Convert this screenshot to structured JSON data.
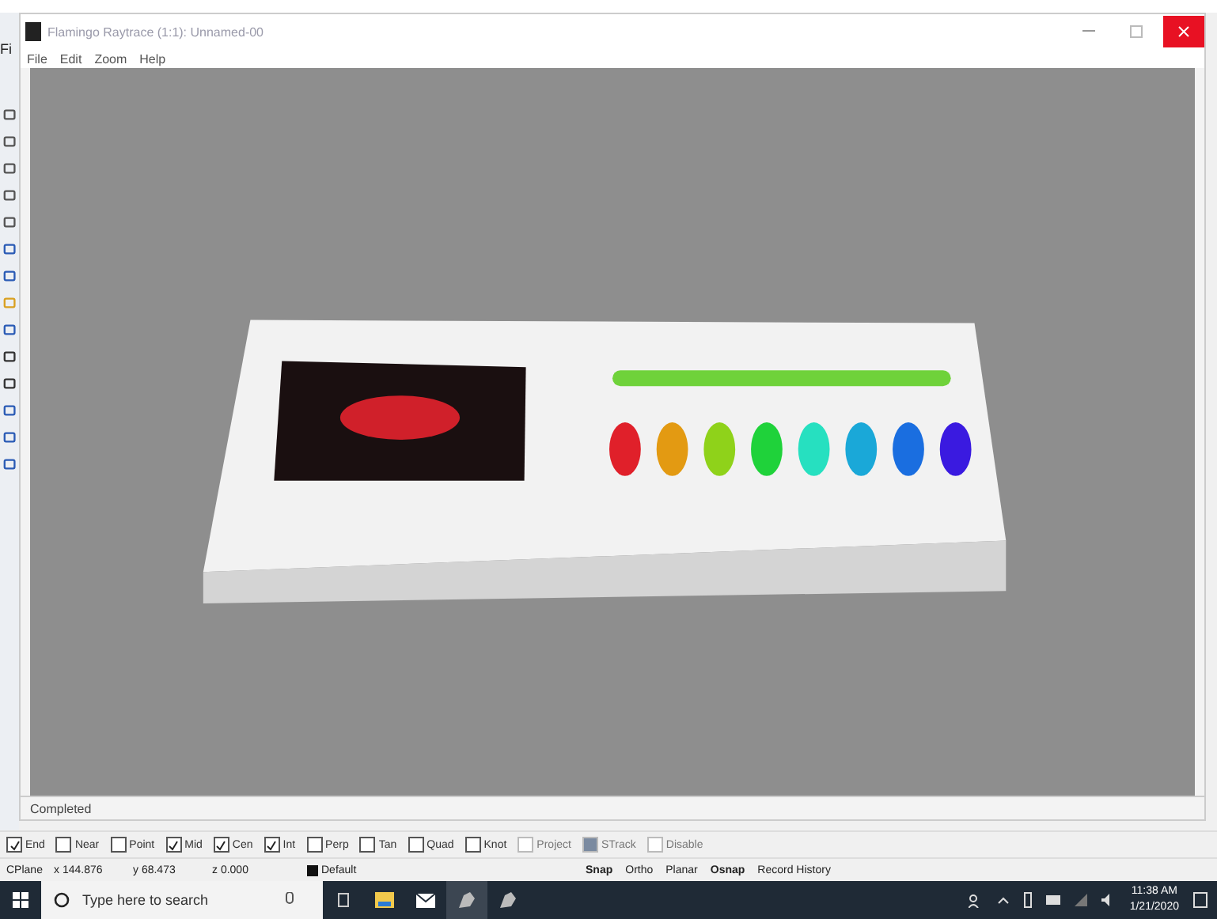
{
  "background_window": {
    "menu_fragment": "Fi"
  },
  "render_window": {
    "title": "Flamingo Raytrace (1:1): Unnamed-00",
    "menu": [
      "File",
      "Edit",
      "Zoom",
      "Help"
    ],
    "render": {
      "kind": "picture"
    },
    "status": "Completed"
  },
  "osnap": [
    {
      "label": "End",
      "checked": true,
      "disabled": false
    },
    {
      "label": "Near",
      "checked": false,
      "disabled": false
    },
    {
      "label": "Point",
      "checked": false,
      "disabled": false
    },
    {
      "label": "Mid",
      "checked": true,
      "disabled": false
    },
    {
      "label": "Cen",
      "checked": true,
      "disabled": false
    },
    {
      "label": "Int",
      "checked": true,
      "disabled": false
    },
    {
      "label": "Perp",
      "checked": false,
      "disabled": false
    },
    {
      "label": "Tan",
      "checked": false,
      "disabled": false
    },
    {
      "label": "Quad",
      "checked": false,
      "disabled": false
    },
    {
      "label": "Knot",
      "checked": false,
      "disabled": false
    },
    {
      "label": "Project",
      "checked": false,
      "disabled": true
    },
    {
      "label": "STrack",
      "checked": true,
      "disabled": true
    },
    {
      "label": "Disable",
      "checked": false,
      "disabled": true
    }
  ],
  "status_bar": {
    "cplane": "CPlane",
    "x": "x 144.876",
    "y": "y 68.473",
    "z": "z 0.000",
    "layer": "Default",
    "toggles": [
      {
        "label": "Snap",
        "on": true
      },
      {
        "label": "Ortho",
        "on": false
      },
      {
        "label": "Planar",
        "on": false
      },
      {
        "label": "Osnap",
        "on": true
      },
      {
        "label": "Record History",
        "on": false
      }
    ]
  },
  "taskbar": {
    "search_placeholder": "Type here to search",
    "time": "11:38 AM",
    "date": "1/21/2020"
  }
}
